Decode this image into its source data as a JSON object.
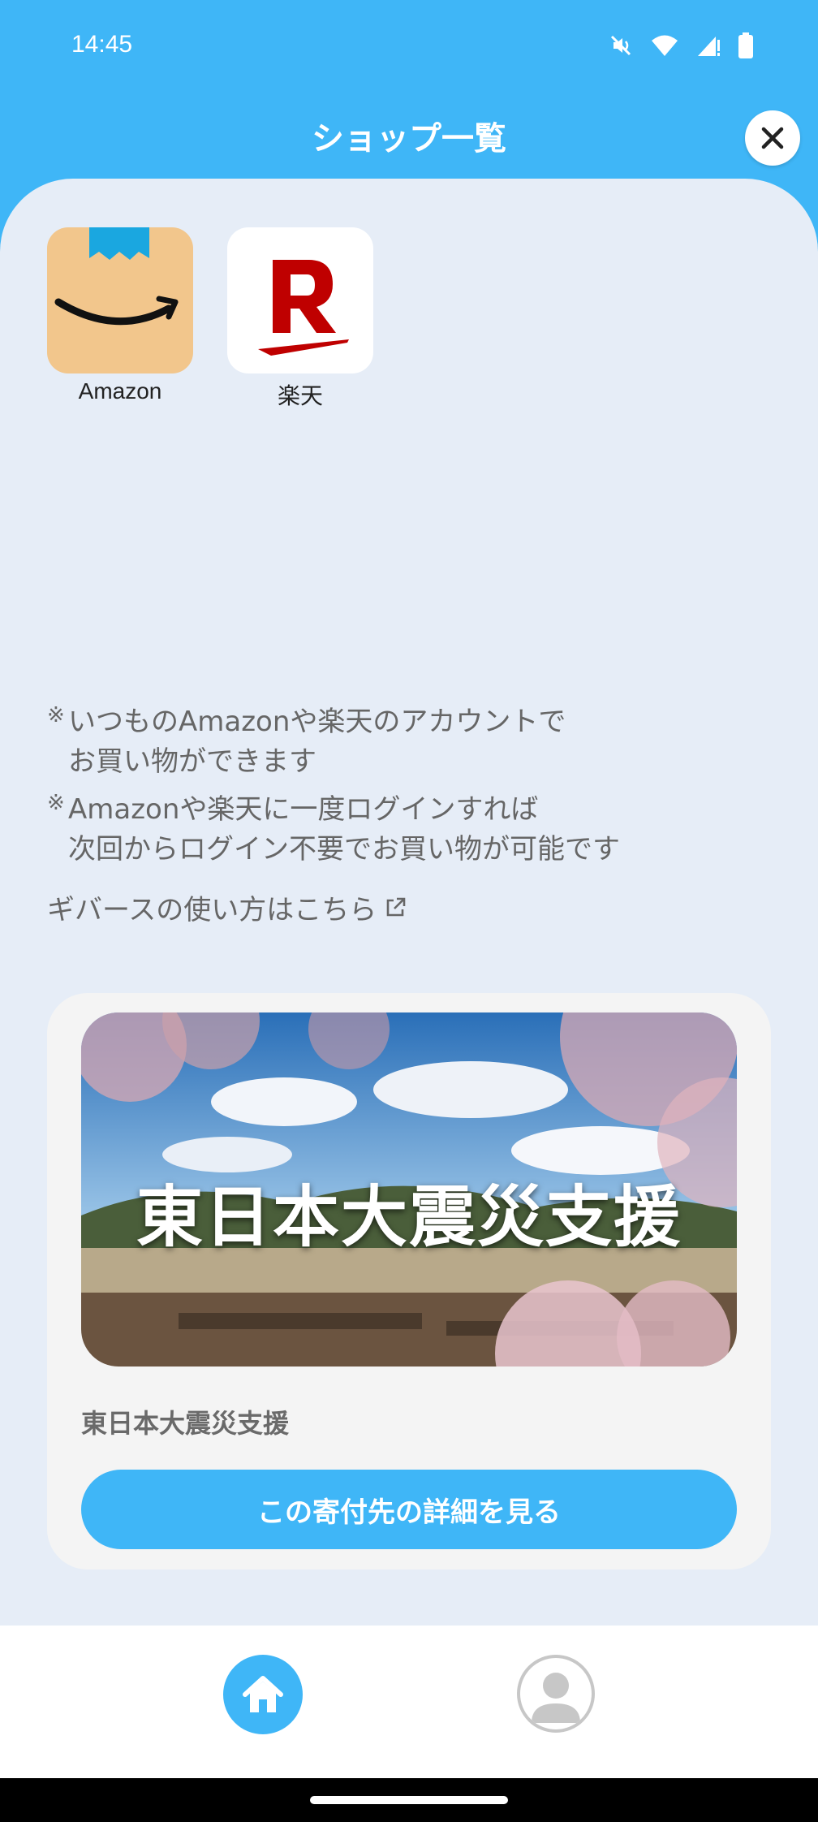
{
  "status_bar": {
    "time": "14:45",
    "icons": [
      "mute-icon",
      "wifi-icon",
      "signal-icon",
      "battery-icon"
    ]
  },
  "header": {
    "title": "ショップ一覧",
    "close_icon": "close-icon"
  },
  "shops": [
    {
      "label": "Amazon",
      "icon": "amazon-logo"
    },
    {
      "label": "楽天",
      "icon": "rakuten-logo"
    }
  ],
  "notes": {
    "mark": "※",
    "items": [
      {
        "line1": "いつものAmazonや楽天のアカウントで",
        "line2": "お買い物ができます"
      },
      {
        "line1": "Amazonや楽天に一度ログインすれば",
        "line2": "次回からログイン不要でお買い物が可能です"
      }
    ],
    "howto_link": "ギバースの使い方はこちら",
    "howto_icon": "external-link-icon"
  },
  "donation_card": {
    "banner_text": "東日本大震災支援",
    "title": "東日本大震災支援",
    "button_label": "この寄付先の詳細を見る"
  },
  "bottom_nav": {
    "items": [
      {
        "icon": "home-icon",
        "active": true
      },
      {
        "icon": "profile-icon",
        "active": false
      }
    ]
  },
  "colors": {
    "primary": "#3fb6f7",
    "background": "#e6edf7",
    "card": "#f4f4f4",
    "text_muted": "#666666",
    "rakuten_red": "#bf0000"
  }
}
